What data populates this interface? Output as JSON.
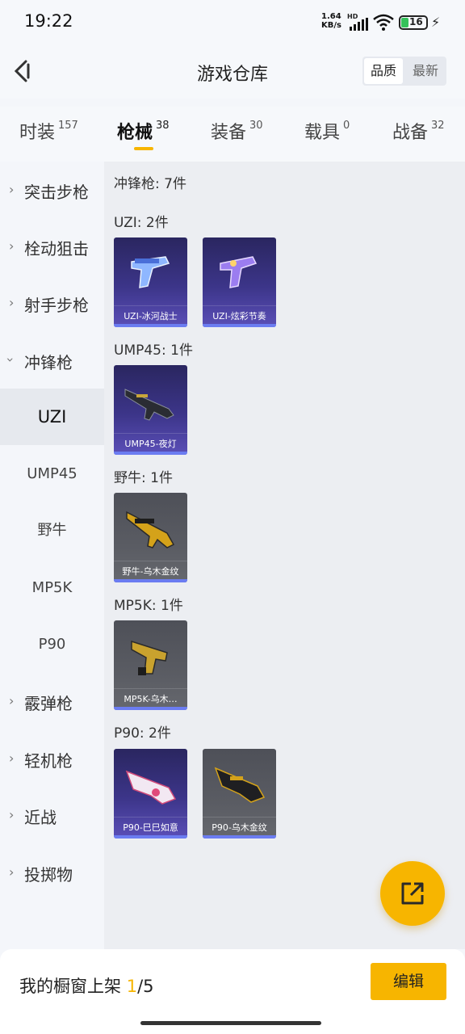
{
  "status": {
    "time": "19:22",
    "speed_value": "1.64",
    "speed_unit": "KB/s",
    "hd": "HD",
    "battery": "16"
  },
  "header": {
    "title": "游戏仓库",
    "sort_options": [
      "品质",
      "最新"
    ]
  },
  "tabs": [
    {
      "label": "时装",
      "count": "157"
    },
    {
      "label": "枪械",
      "count": "38"
    },
    {
      "label": "装备",
      "count": "30"
    },
    {
      "label": "载具",
      "count": "0"
    },
    {
      "label": "战备",
      "count": "32"
    }
  ],
  "sidebar": {
    "categories_top": [
      "突击步枪",
      "栓动狙击",
      "射手步枪"
    ],
    "expanded": "冲锋枪",
    "sub_items": [
      "UZI",
      "UMP45",
      "野牛",
      "MP5K",
      "P90"
    ],
    "categories_bottom": [
      "霰弹枪",
      "轻机枪",
      "近战",
      "投掷物"
    ]
  },
  "content": {
    "section_title": "冲锋枪: 7件",
    "groups": [
      {
        "title": "UZI: 2件",
        "items": [
          {
            "name": "UZI-冰河战士",
            "style": "purple"
          },
          {
            "name": "UZI-炫彩节奏",
            "style": "purple"
          }
        ]
      },
      {
        "title": "UMP45: 1件",
        "items": [
          {
            "name": "UMP45-夜灯",
            "style": "purple"
          }
        ]
      },
      {
        "title": "野牛: 1件",
        "items": [
          {
            "name": "野牛-乌木金纹",
            "style": "grey"
          }
        ]
      },
      {
        "title": "MP5K: 1件",
        "items": [
          {
            "name": "MP5K-乌木…",
            "style": "grey"
          }
        ]
      },
      {
        "title": "P90: 2件",
        "items": [
          {
            "name": "P90-巳巳如意",
            "style": "purple"
          },
          {
            "name": "P90-乌木金纹",
            "style": "grey"
          }
        ]
      }
    ]
  },
  "bottom": {
    "label": "我的橱窗上架",
    "current": "1",
    "total": "/5",
    "edit_label": "编辑"
  },
  "colors": {
    "accent": "#f7b500",
    "card_purple": "#3c3589",
    "card_grey": "#5a5c63",
    "stripe": "#6b7cf1"
  }
}
